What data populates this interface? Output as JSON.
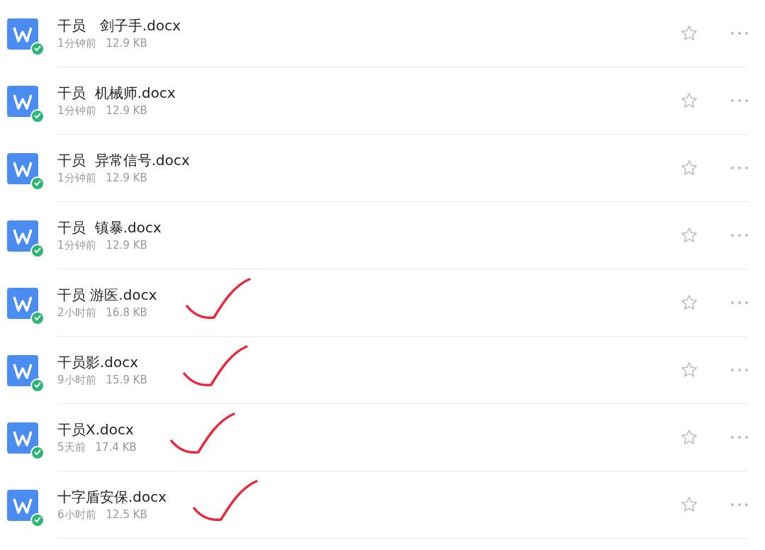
{
  "files": [
    {
      "name": "干员　剑子手.docx",
      "time": "1分钟前",
      "size": "12.9 KB",
      "starred": false,
      "hand_checked": false
    },
    {
      "name": "干员  机械师.docx",
      "time": "1分钟前",
      "size": "12.9 KB",
      "starred": false,
      "hand_checked": false
    },
    {
      "name": "干员  异常信号.docx",
      "time": "1分钟前",
      "size": "12.9 KB",
      "starred": false,
      "hand_checked": false
    },
    {
      "name": "干员  镇暴.docx",
      "time": "1分钟前",
      "size": "12.9 KB",
      "starred": false,
      "hand_checked": false
    },
    {
      "name": "干员 游医.docx",
      "time": "2小时前",
      "size": "16.8 KB",
      "starred": false,
      "hand_checked": true
    },
    {
      "name": "干员影.docx",
      "time": "9小时前",
      "size": "15.9 KB",
      "starred": false,
      "hand_checked": true
    },
    {
      "name": "干员X.docx",
      "time": "5天前",
      "size": "17.4 KB",
      "starred": false,
      "hand_checked": true
    },
    {
      "name": "十字盾安保.docx",
      "time": "6小时前",
      "size": "12.5 KB",
      "starred": false,
      "hand_checked": true
    }
  ]
}
